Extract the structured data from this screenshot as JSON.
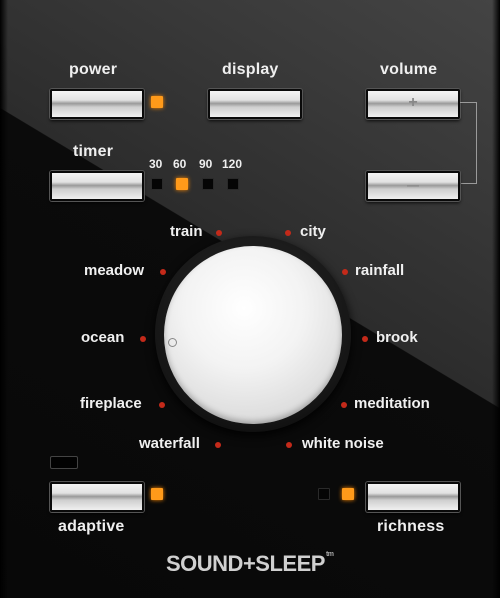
{
  "controls": {
    "power_label": "power",
    "display_label": "display",
    "volume_label": "volume",
    "volume_up_glyph": "+",
    "volume_down_glyph": "—",
    "timer_label": "timer",
    "adaptive_label": "adaptive",
    "richness_label": "richness"
  },
  "timer_options": [
    "30",
    "60",
    "90",
    "120"
  ],
  "sounds": {
    "train": "train",
    "city": "city",
    "meadow": "meadow",
    "rainfall": "rainfall",
    "ocean": "ocean",
    "brook": "brook",
    "fireplace": "fireplace",
    "meditation": "meditation",
    "waterfall": "waterfall",
    "white_noise": "white noise"
  },
  "brand": {
    "name": "SOUND+SLEEP",
    "tm": "tm"
  },
  "colors": {
    "led_on": "#ff9a1a",
    "sound_dot": "#c42a1a"
  },
  "indicators": {
    "power_led": "on",
    "timer_selected": "60",
    "adaptive_led": "on",
    "richness_leds": [
      "off",
      "on"
    ]
  }
}
